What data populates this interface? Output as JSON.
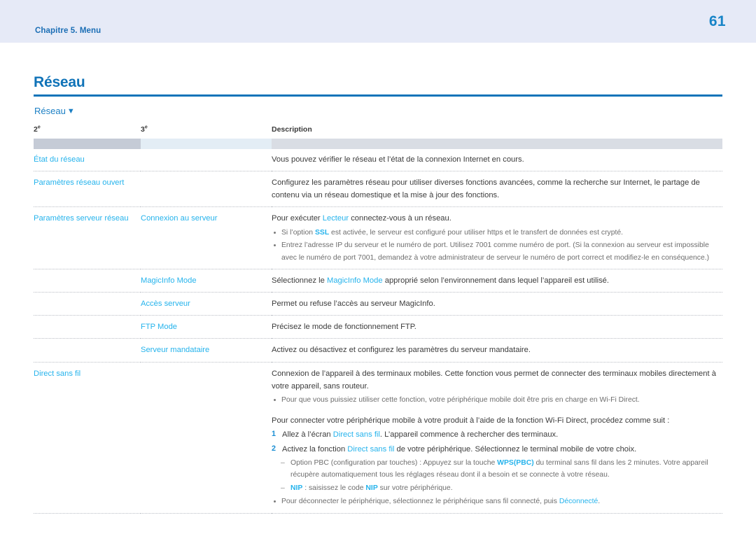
{
  "header": {
    "chapter_label": "Chapitre 5. Menu",
    "page_number": "61",
    "band_color": "#e6eaf7",
    "label_color": "#1b6eb5",
    "page_number_color": "#1784c7"
  },
  "section": {
    "title": "Réseau",
    "title_color": "#1073b8",
    "rule_color": "#0f74b9"
  },
  "table_caption": {
    "label": "Réseau",
    "caret_icon": "▼"
  },
  "accent": {
    "link_blue": "#25b3ec",
    "number_blue": "#1b8fd4",
    "body_gray": "#3c3c3c",
    "note_gray": "#6d6d6d"
  },
  "table": {
    "columns": [
      {
        "label": "2",
        "sup": "e"
      },
      {
        "label": "3",
        "sup": "e"
      },
      {
        "label": "Description",
        "sup": ""
      }
    ],
    "rows": [
      {
        "lv2": "État du réseau",
        "lv3": "",
        "desc": [
          {
            "type": "p",
            "parts": [
              {
                "t": "Vous pouvez vérifier le réseau et l’état de la connexion Internet en cours."
              }
            ]
          }
        ]
      },
      {
        "lv2": "Paramètres réseau ouvert",
        "lv3": "",
        "desc": [
          {
            "type": "p",
            "parts": [
              {
                "t": "Configurez les paramètres réseau pour utiliser diverses fonctions avancées, comme la recherche sur Internet, le partage de contenu via un réseau domestique et la mise à jour des fonctions."
              }
            ]
          }
        ]
      },
      {
        "lv2": "Paramètres serveur réseau",
        "lv3": "Connexion au serveur",
        "desc": [
          {
            "type": "p",
            "parts": [
              {
                "t": "Pour exécuter "
              },
              {
                "t": "Lecteur",
                "hl": true
              },
              {
                "t": " connectez-vous à un réseau."
              }
            ]
          },
          {
            "type": "bullets",
            "items": [
              {
                "parts": [
                  {
                    "t": "Si l’option "
                  },
                  {
                    "t": "SSL",
                    "hlb": true
                  },
                  {
                    "t": " est activée, le serveur est configuré pour utiliser https et le transfert de données est crypté."
                  }
                ]
              },
              {
                "parts": [
                  {
                    "t": "Entrez l’adresse IP du serveur et le numéro de port. Utilisez 7001 comme numéro de port. (Si la connexion au serveur est impossible avec le numéro de port 7001, demandez à votre administrateur de serveur le numéro de port correct et modifiez-le en conséquence.)"
                  }
                ]
              }
            ]
          }
        ]
      },
      {
        "lv2": "",
        "lv3": "MagicInfo Mode",
        "desc": [
          {
            "type": "p",
            "parts": [
              {
                "t": "Sélectionnez le "
              },
              {
                "t": "MagicInfo Mode",
                "hl": true
              },
              {
                "t": " approprié selon l’environnement dans lequel l’appareil est utilisé."
              }
            ]
          }
        ]
      },
      {
        "lv2": "",
        "lv3": "Accès serveur",
        "desc": [
          {
            "type": "p",
            "parts": [
              {
                "t": "Permet ou refuse l’accès au serveur MagicInfo."
              }
            ]
          }
        ]
      },
      {
        "lv2": "",
        "lv3": "FTP Mode",
        "desc": [
          {
            "type": "p",
            "parts": [
              {
                "t": "Précisez le mode de fonctionnement FTP."
              }
            ]
          }
        ]
      },
      {
        "lv2": "",
        "lv3": "Serveur mandataire",
        "desc": [
          {
            "type": "p",
            "parts": [
              {
                "t": "Activez ou désactivez et configurez les paramètres du serveur mandataire."
              }
            ]
          }
        ]
      },
      {
        "lv2": "Direct sans fil",
        "lv3": "",
        "desc": [
          {
            "type": "p",
            "parts": [
              {
                "t": "Connexion de l’appareil à des terminaux mobiles. Cette fonction vous permet de connecter des terminaux mobiles directement à votre appareil, sans routeur."
              }
            ]
          },
          {
            "type": "bullets",
            "items": [
              {
                "parts": [
                  {
                    "t": "Pour que vous puissiez utiliser cette fonction, votre périphérique mobile doit être pris en charge en Wi-Fi Direct."
                  }
                ]
              }
            ]
          },
          {
            "type": "intro",
            "parts": [
              {
                "t": "Pour connecter votre périphérique mobile à votre produit à l’aide de la fonction Wi-Fi Direct, procédez comme suit :"
              }
            ]
          },
          {
            "type": "numbered",
            "items": [
              {
                "num": "1",
                "parts": [
                  {
                    "t": "Allez à l’écran "
                  },
                  {
                    "t": "Direct sans fil",
                    "hl": true
                  },
                  {
                    "t": ". L’appareil commence à rechercher des terminaux."
                  }
                ]
              },
              {
                "num": "2",
                "parts": [
                  {
                    "t": "Activez la fonction "
                  },
                  {
                    "t": "Direct sans fil",
                    "hl": true
                  },
                  {
                    "t": " de votre périphérique. Sélectionnez le terminal mobile de votre choix."
                  }
                ]
              }
            ]
          },
          {
            "type": "dashes",
            "items": [
              {
                "parts": [
                  {
                    "t": "Option PBC (configuration par touches) : Appuyez sur la touche "
                  },
                  {
                    "t": "WPS(PBC)",
                    "hlb": true
                  },
                  {
                    "t": " du terminal sans fil dans les 2 minutes. Votre appareil récupère automatiquement tous les réglages réseau dont il a besoin et se connecte à votre réseau."
                  }
                ]
              },
              {
                "parts": [
                  {
                    "t": "",
                    "pre": true
                  },
                  {
                    "t": "NIP",
                    "hlb": true
                  },
                  {
                    "t": " : saisissez le code "
                  },
                  {
                    "t": "NIP",
                    "hlb": true
                  },
                  {
                    "t": " sur votre périphérique."
                  }
                ]
              }
            ]
          },
          {
            "type": "bullets",
            "items": [
              {
                "parts": [
                  {
                    "t": "Pour déconnecter le périphérique, sélectionnez le périphérique sans fil connecté, puis "
                  },
                  {
                    "t": "Déconnecté",
                    "hl": true
                  },
                  {
                    "t": "."
                  }
                ]
              }
            ]
          }
        ]
      }
    ]
  }
}
